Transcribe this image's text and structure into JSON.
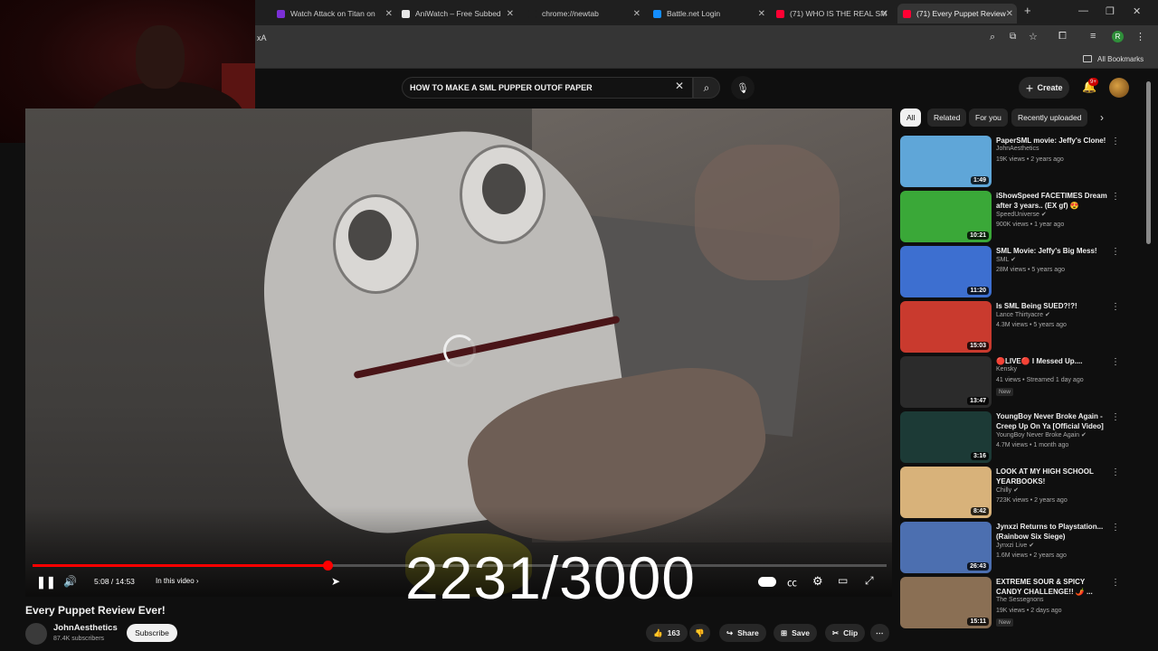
{
  "browser": {
    "tabs": [
      {
        "label": "Watch Attack on Titan on",
        "color": "#7b2fd6"
      },
      {
        "label": "AniWatch – Free Subbed",
        "color": "#e6e6e6"
      },
      {
        "label": "chrome://newtab",
        "color": "#1f1f1f"
      },
      {
        "label": "Battle.net Login",
        "color": "#148eff"
      },
      {
        "label": "(71) WHO IS THE REAL SM",
        "color": "#ff0033"
      },
      {
        "label": "(71) Every Puppet Review",
        "color": "#ff0033"
      }
    ],
    "address_fragment": "xA",
    "new_tab": "+",
    "bookmarks_label": "All Bookmarks",
    "profile_letter": "R"
  },
  "youtube": {
    "search_query": "HOW TO MAKE A SML PUPPER OUTOF PAPER",
    "create_label": "Create",
    "notification_badge": "9+"
  },
  "player": {
    "time": "5:08 / 14:53",
    "in_this_video": "In this video",
    "progress": 0.345,
    "overlay_counter": "2231/3000"
  },
  "video_info": {
    "title": "Every Puppet Review Ever!",
    "channel": "JohnAesthetics",
    "subscribers": "87.4K subscribers",
    "subscribe_label": "Subscribe",
    "likes": "163",
    "share_label": "Share",
    "save_label": "Save",
    "clip_label": "Clip"
  },
  "chips": [
    "All",
    "Related",
    "For you",
    "Recently uploaded"
  ],
  "related": [
    {
      "title": "PaperSML movie: Jeffy's Clone!",
      "channel": "JohnAesthetics",
      "meta": "19K views • 2 years ago",
      "duration": "1:49",
      "thumb": "#5fa6d8",
      "verified": false,
      "new": false
    },
    {
      "title": "iShowSpeed FACETIMES Dream after 3 years.. (EX gf) 😍",
      "channel": "SpeedUniverse",
      "meta": "900K views • 1 year ago",
      "duration": "10:21",
      "thumb": "#3aa838",
      "verified": true,
      "new": false
    },
    {
      "title": "SML Movie: Jeffy's Big Mess!",
      "channel": "SML",
      "meta": "28M views • 5 years ago",
      "duration": "11:20",
      "thumb": "#3d6fd0",
      "verified": true,
      "new": false
    },
    {
      "title": "Is SML Being SUED?!?!",
      "channel": "Lance Thirtyacre",
      "meta": "4.3M views • 5 years ago",
      "duration": "15:03",
      "thumb": "#c93a2e",
      "verified": true,
      "new": false
    },
    {
      "title": "🔴LIVE🔴 I Messed Up....",
      "channel": "Kensky",
      "meta": "41 views • Streamed 1 day ago",
      "duration": "13:47",
      "thumb": "#2b2b2b",
      "verified": false,
      "new": true
    },
    {
      "title": "YoungBoy Never Broke Again - Creep Up On Ya [Official Video]",
      "channel": "YoungBoy Never Broke Again",
      "meta": "4.7M views • 1 month ago",
      "duration": "3:16",
      "thumb": "#1c3a36",
      "verified": true,
      "new": false
    },
    {
      "title": "LOOK AT MY HIGH SCHOOL YEARBOOKS!",
      "channel": "Chilly",
      "meta": "723K views • 2 years ago",
      "duration": "8:42",
      "thumb": "#d8b27a",
      "verified": true,
      "new": false
    },
    {
      "title": "Jynxzi Returns to Playstation... (Rainbow Six Siege)",
      "channel": "Jynxzi Live",
      "meta": "1.6M views • 2 years ago",
      "duration": "26:43",
      "thumb": "#4c6fb0",
      "verified": true,
      "new": false
    },
    {
      "title": "EXTREME SOUR & SPICY CANDY CHALLENGE!! 🌶️ ...",
      "channel": "The Sessegnons",
      "meta": "19K views • 2 days ago",
      "duration": "15:11",
      "thumb": "#8a6f54",
      "verified": false,
      "new": true
    }
  ]
}
